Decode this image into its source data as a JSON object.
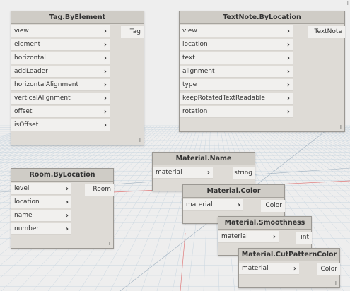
{
  "corner_mark": "I",
  "nodes": {
    "tag": {
      "title": "Tag.ByElement",
      "inputs": [
        "view",
        "element",
        "horizontal",
        "addLeader",
        "horizontalAlignment",
        "verticalAlignment",
        "offset",
        "isOffset"
      ],
      "output": "Tag",
      "footer": "I"
    },
    "textnote": {
      "title": "TextNote.ByLocation",
      "inputs": [
        "view",
        "location",
        "text",
        "alignment",
        "type",
        "keepRotatedTextReadable",
        "rotation"
      ],
      "output": "TextNote",
      "footer": "I"
    },
    "room": {
      "title": "Room.ByLocation",
      "inputs": [
        "level",
        "location",
        "name",
        "number"
      ],
      "output": "Room",
      "footer": "I"
    },
    "mat_name": {
      "title": "Material.Name",
      "inputs": [
        "material"
      ],
      "output": "string"
    },
    "mat_color": {
      "title": "Material.Color",
      "inputs": [
        "material"
      ],
      "output": "Color"
    },
    "mat_smooth": {
      "title": "Material.Smoothness",
      "inputs": [
        "material"
      ],
      "output": "int"
    },
    "mat_cut": {
      "title": "Material.CutPatternColor",
      "inputs": [
        "material"
      ],
      "output": "Color",
      "footer": "I"
    }
  }
}
